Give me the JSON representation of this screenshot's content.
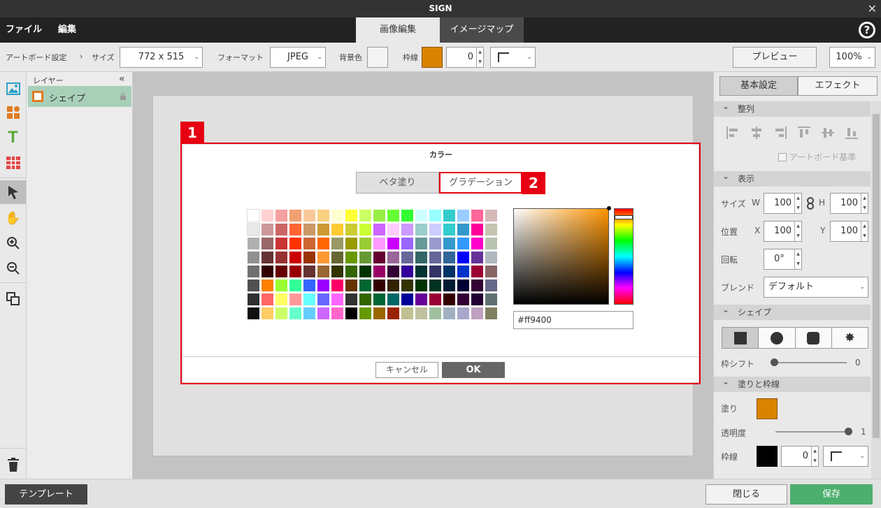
{
  "app": {
    "title": "SIGN"
  },
  "menu": {
    "file": "ファイル",
    "edit": "編集"
  },
  "mode_tabs": {
    "image_edit": "画像編集",
    "image_map": "イメージマップ"
  },
  "help": "?",
  "toolbar": {
    "artboard_settings": "アートボード設定",
    "separator": "›",
    "size_label": "サイズ",
    "size_value": "772 x 515",
    "format_label": "フォーマット",
    "format_value": "JPEG",
    "bg_label": "背景色",
    "border_label": "枠線",
    "border_color": "#d98300",
    "border_width": "0",
    "preview": "プレビュー",
    "zoom": "100%"
  },
  "layers": {
    "header": "レイヤー",
    "collapse": "«",
    "items": [
      {
        "name": "シェイプ"
      }
    ]
  },
  "color_dialog": {
    "title": "カラー",
    "tab_solid": "ベタ塗り",
    "tab_gradient": "グラデーション",
    "hex_value": "#ff9400",
    "cancel": "キャンセル",
    "ok": "OK",
    "palette": [
      "#ffffff",
      "#ffd1d1",
      "#f4a0a0",
      "#f0a070",
      "#f8c898",
      "#f8d080",
      "#ffffd0",
      "#ffff33",
      "#ccff66",
      "#99ee44",
      "#66ff33",
      "#33ff33",
      "#ccffff",
      "#99ffff",
      "#33cccc",
      "#99ccff",
      "#ff6699",
      "#d4b8b8",
      "#e8e8e8",
      "#cc9999",
      "#cc6666",
      "#ff6633",
      "#cc9966",
      "#cc9933",
      "#ffcc33",
      "#cccc33",
      "#ccff33",
      "#cc66ff",
      "#ffccff",
      "#cc99ff",
      "#99cccc",
      "#ccccff",
      "#33cccc",
      "#3399cc",
      "#ff0099",
      "#c4c4b0",
      "#b0b0b0",
      "#996666",
      "#cc3333",
      "#ff3300",
      "#cc6633",
      "#ff6600",
      "#999966",
      "#999900",
      "#99cc33",
      "#ff99ff",
      "#cc00ff",
      "#9966ff",
      "#669999",
      "#9999cc",
      "#3399cc",
      "#3399ff",
      "#ff00cc",
      "#b8c4b0",
      "#909090",
      "#663333",
      "#993333",
      "#cc0000",
      "#993300",
      "#ff9933",
      "#666633",
      "#669900",
      "#669933",
      "#660033",
      "#996699",
      "#666699",
      "#336666",
      "#666699",
      "#336699",
      "#0000ff",
      "#663399",
      "#b0b8c0",
      "#707070",
      "#330000",
      "#660000",
      "#990000",
      "#663333",
      "#996633",
      "#333300",
      "#336600",
      "#003300",
      "#990066",
      "#330033",
      "#330099",
      "#003333",
      "#333366",
      "#003366",
      "#0033cc",
      "#990033",
      "#886666",
      "#505050",
      "#ff8000",
      "#99ff33",
      "#33ff99",
      "#3366ff",
      "#9900ff",
      "#ff0066",
      "#663300",
      "#006633",
      "#330000",
      "#332200",
      "#333300",
      "#003300",
      "#003322",
      "#001a33",
      "#000033",
      "#330033",
      "#666688",
      "#303030",
      "#ff6666",
      "#ffff66",
      "#ff9999",
      "#66ffff",
      "#6666ff",
      "#ff66ff",
      "#333333",
      "#336600",
      "#006633",
      "#006666",
      "#000099",
      "#660099",
      "#990033",
      "#330000",
      "#330033",
      "#220033",
      "#607070",
      "#101010",
      "#ffcc66",
      "#ccff66",
      "#66ffcc",
      "#66ccff",
      "#cc66ff",
      "#ff66cc",
      "#000000",
      "#669900",
      "#996600",
      "#992200",
      "#c0c090",
      "#c0c0a0",
      "#a0c0a0",
      "#a0b0c0",
      "#a8a8cc",
      "#c0a0c0",
      "#808060"
    ]
  },
  "annotations": {
    "badge1": "1",
    "badge2": "2"
  },
  "right_panel": {
    "tab_basic": "基本設定",
    "tab_effect": "エフェクト",
    "align": {
      "header": "整列",
      "artboard_ref": "アートボード基準"
    },
    "display": {
      "header": "表示",
      "size_label": "サイズ",
      "w_label": "W",
      "w_value": "100",
      "h_label": "H",
      "h_value": "100",
      "pos_label": "位置",
      "x_label": "X",
      "x_value": "100",
      "y_label": "Y",
      "y_value": "100",
      "rotate_label": "回転",
      "rotate_value": "0°",
      "blend_label": "ブレンド",
      "blend_value": "デフォルト"
    },
    "shape": {
      "header": "シェイプ",
      "shift_label": "枠シフト",
      "shift_value": "0",
      "shift_level": 0
    },
    "fill": {
      "header": "塗りと枠線",
      "fill_label": "塗り",
      "fill_color": "#d98300",
      "opacity_label": "透明度",
      "opacity_value": "1",
      "opacity_level": 1,
      "border_label": "枠線",
      "border_color": "#000000",
      "border_width": "0"
    }
  },
  "bottom": {
    "template": "テンプレート",
    "close": "閉じる",
    "save": "保存"
  }
}
